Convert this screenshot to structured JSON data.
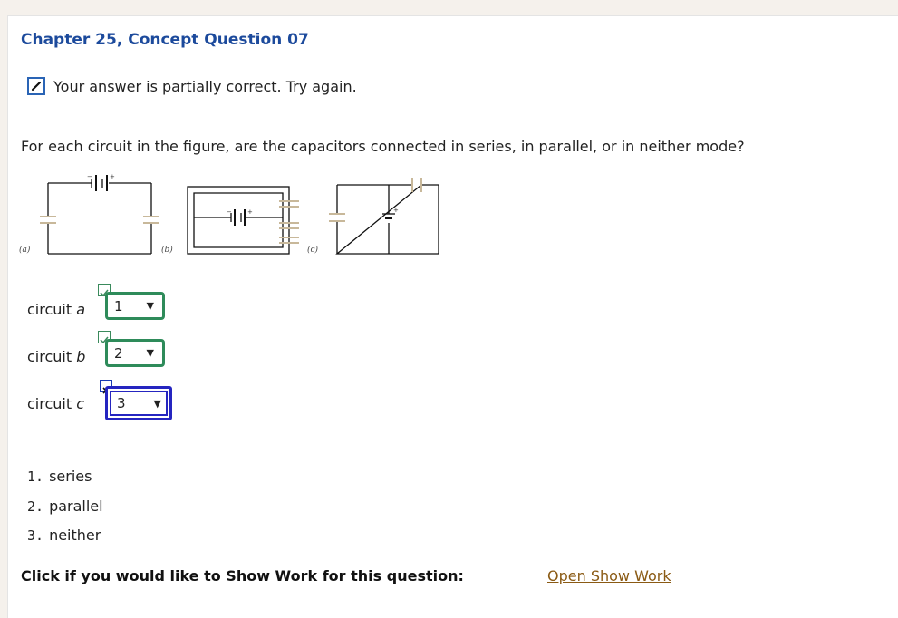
{
  "header": {
    "title": "Chapter 25, Concept Question 07"
  },
  "status": {
    "message": "Your answer is partially correct.  Try again.",
    "icon": "pencil-icon"
  },
  "question": {
    "text": "For each circuit in the figure, are the capacitors connected in series, in parallel, or in neither mode?"
  },
  "figure": {
    "labels": [
      "(a)",
      "(b)",
      "(c)"
    ]
  },
  "answers": [
    {
      "label_prefix": "circuit ",
      "label_var": "a",
      "value": "1",
      "result": "correct"
    },
    {
      "label_prefix": "circuit ",
      "label_var": "b",
      "value": "2",
      "result": "correct"
    },
    {
      "label_prefix": "circuit ",
      "label_var": "c",
      "value": "3",
      "result": "incorrect"
    }
  ],
  "options": [
    {
      "num": "1.",
      "text": "series"
    },
    {
      "num": "2.",
      "text": "parallel"
    },
    {
      "num": "3.",
      "text": "neither"
    }
  ],
  "show_work": {
    "prompt": "Click if you would like to Show Work for this question:",
    "link": "Open Show Work"
  },
  "colors": {
    "title": "#1c4a9c",
    "correct": "#2e8b5a",
    "incorrect": "#2525c0",
    "link": "#8a5a14"
  }
}
